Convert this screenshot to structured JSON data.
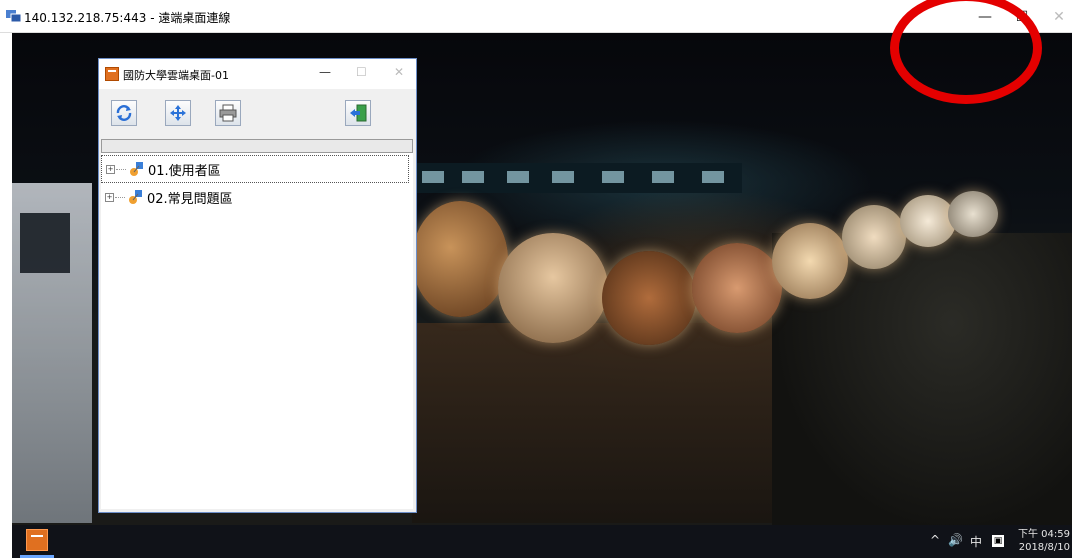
{
  "rdp_window": {
    "title": "140.132.218.75:443 - 遠端桌面連線",
    "minimize": "—",
    "maximize": "☐",
    "close": "✕"
  },
  "app_window": {
    "title": "國防大學雲端桌面-01",
    "minimize": "—",
    "maximize": "☐",
    "close": "✕",
    "toolbar": [
      {
        "name": "refresh-icon"
      },
      {
        "name": "move-icon"
      },
      {
        "name": "print-icon"
      },
      {
        "name": "exit-icon"
      }
    ],
    "tree": [
      {
        "label": "01.使用者區",
        "expander": "+"
      },
      {
        "label": "02.常見問題區",
        "expander": "+"
      }
    ]
  },
  "taskbar": {
    "chevron": "^",
    "volume": "🔊",
    "ime": "中",
    "ime2": "▣",
    "time": "下午 04:59",
    "date": "2018/8/10"
  },
  "colors": {
    "annotation_circle": "#e40000",
    "app_icon": "#e07020"
  }
}
